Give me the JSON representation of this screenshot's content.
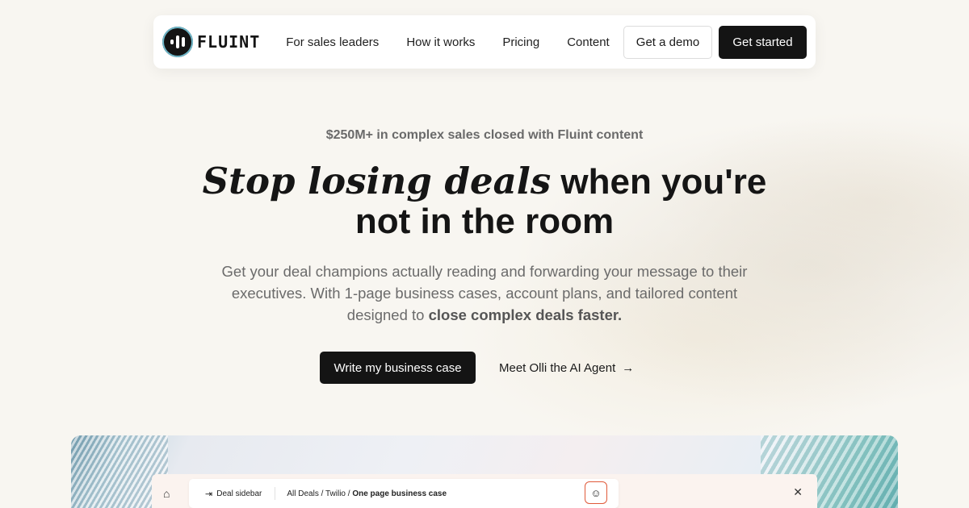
{
  "nav": {
    "logo_text": "FLUINT",
    "links": [
      "For sales leaders",
      "How it works",
      "Pricing",
      "Content"
    ],
    "demo_label": "Get a demo",
    "start_label": "Get started"
  },
  "hero": {
    "eyebrow": "$250M+ in complex sales closed with Fluint content",
    "headline_italic": "Stop losing deals",
    "headline_rest_1": " when you're",
    "headline_rest_2": "not in the room",
    "sub_1": "Get your deal champions actually reading and forwarding your message to their executives. With 1-page business cases, account plans, and tailored content designed to ",
    "sub_bold": "close complex deals faster.",
    "cta_primary": "Write my business case",
    "cta_secondary": "Meet Olli the AI Agent"
  },
  "preview": {
    "sidebar_label": "Deal sidebar",
    "breadcrumb_prefix": "All Deals / Twilio / ",
    "breadcrumb_current": "One page business case"
  },
  "icons": {
    "logo": "fluint-logo-icon",
    "arrow": "arrow-right-icon",
    "home": "home-icon",
    "sidebar": "sidebar-toggle-icon",
    "avatar": "olli-face-icon",
    "close": "close-icon"
  },
  "colors": {
    "primary_button": "#141414",
    "background": "#f8f6f1"
  }
}
